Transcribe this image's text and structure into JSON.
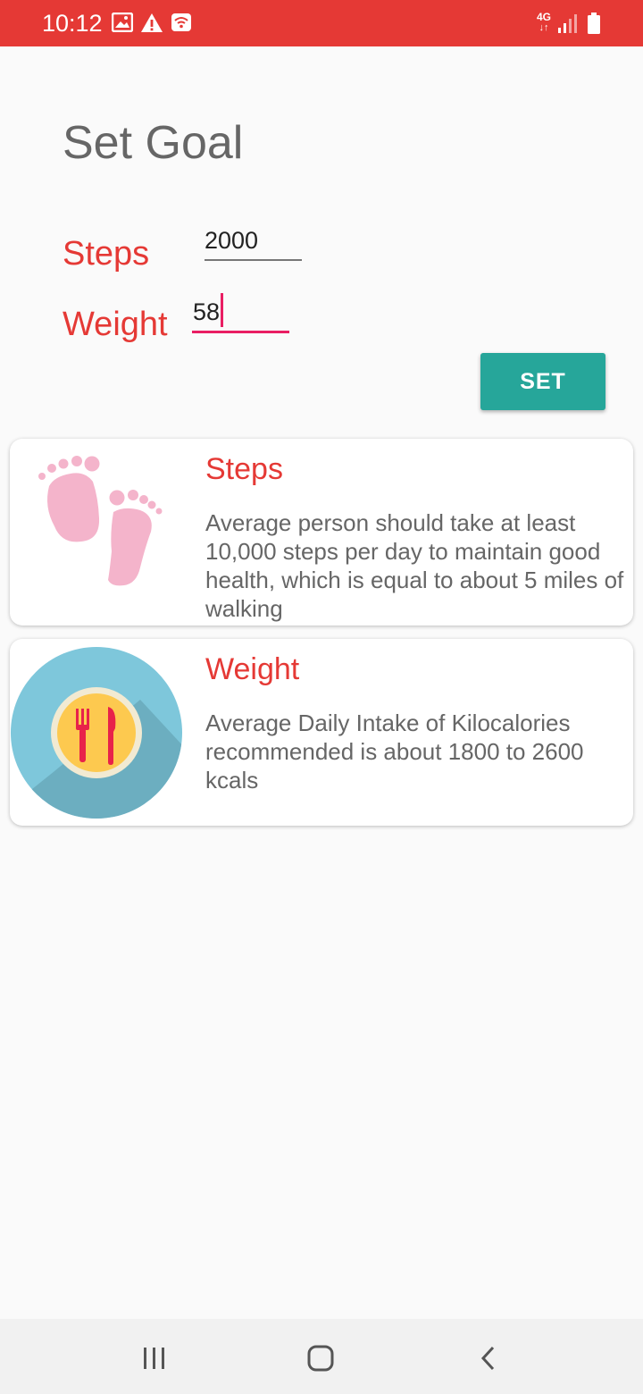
{
  "status_bar": {
    "time": "10:12",
    "network": "4G",
    "icons": [
      "image-icon",
      "warning-icon",
      "wifi-icon",
      "signal-icon",
      "battery-icon"
    ],
    "background_color": "#e53935"
  },
  "goal": {
    "title": "Set Goal",
    "steps_label": "Steps",
    "steps_value": "2000",
    "weight_label": "Weight",
    "weight_value": "58",
    "set_button_label": "SET",
    "button_color": "#26a69a",
    "accent_color": "#e53935"
  },
  "cards": {
    "steps": {
      "title": "Steps",
      "body": "Average person should take at least 10,000 steps per day to maintain good health, which is equal to about 5 miles of walking",
      "icon": "footprints-icon"
    },
    "weight": {
      "title": "Weight",
      "body": "Average Daily Intake of Kilocalories recommended is about 1800 to 2600 kcals",
      "icon": "plate-cutlery-icon"
    }
  },
  "nav": {
    "items": [
      "recent-apps-icon",
      "home-icon",
      "back-icon"
    ]
  }
}
